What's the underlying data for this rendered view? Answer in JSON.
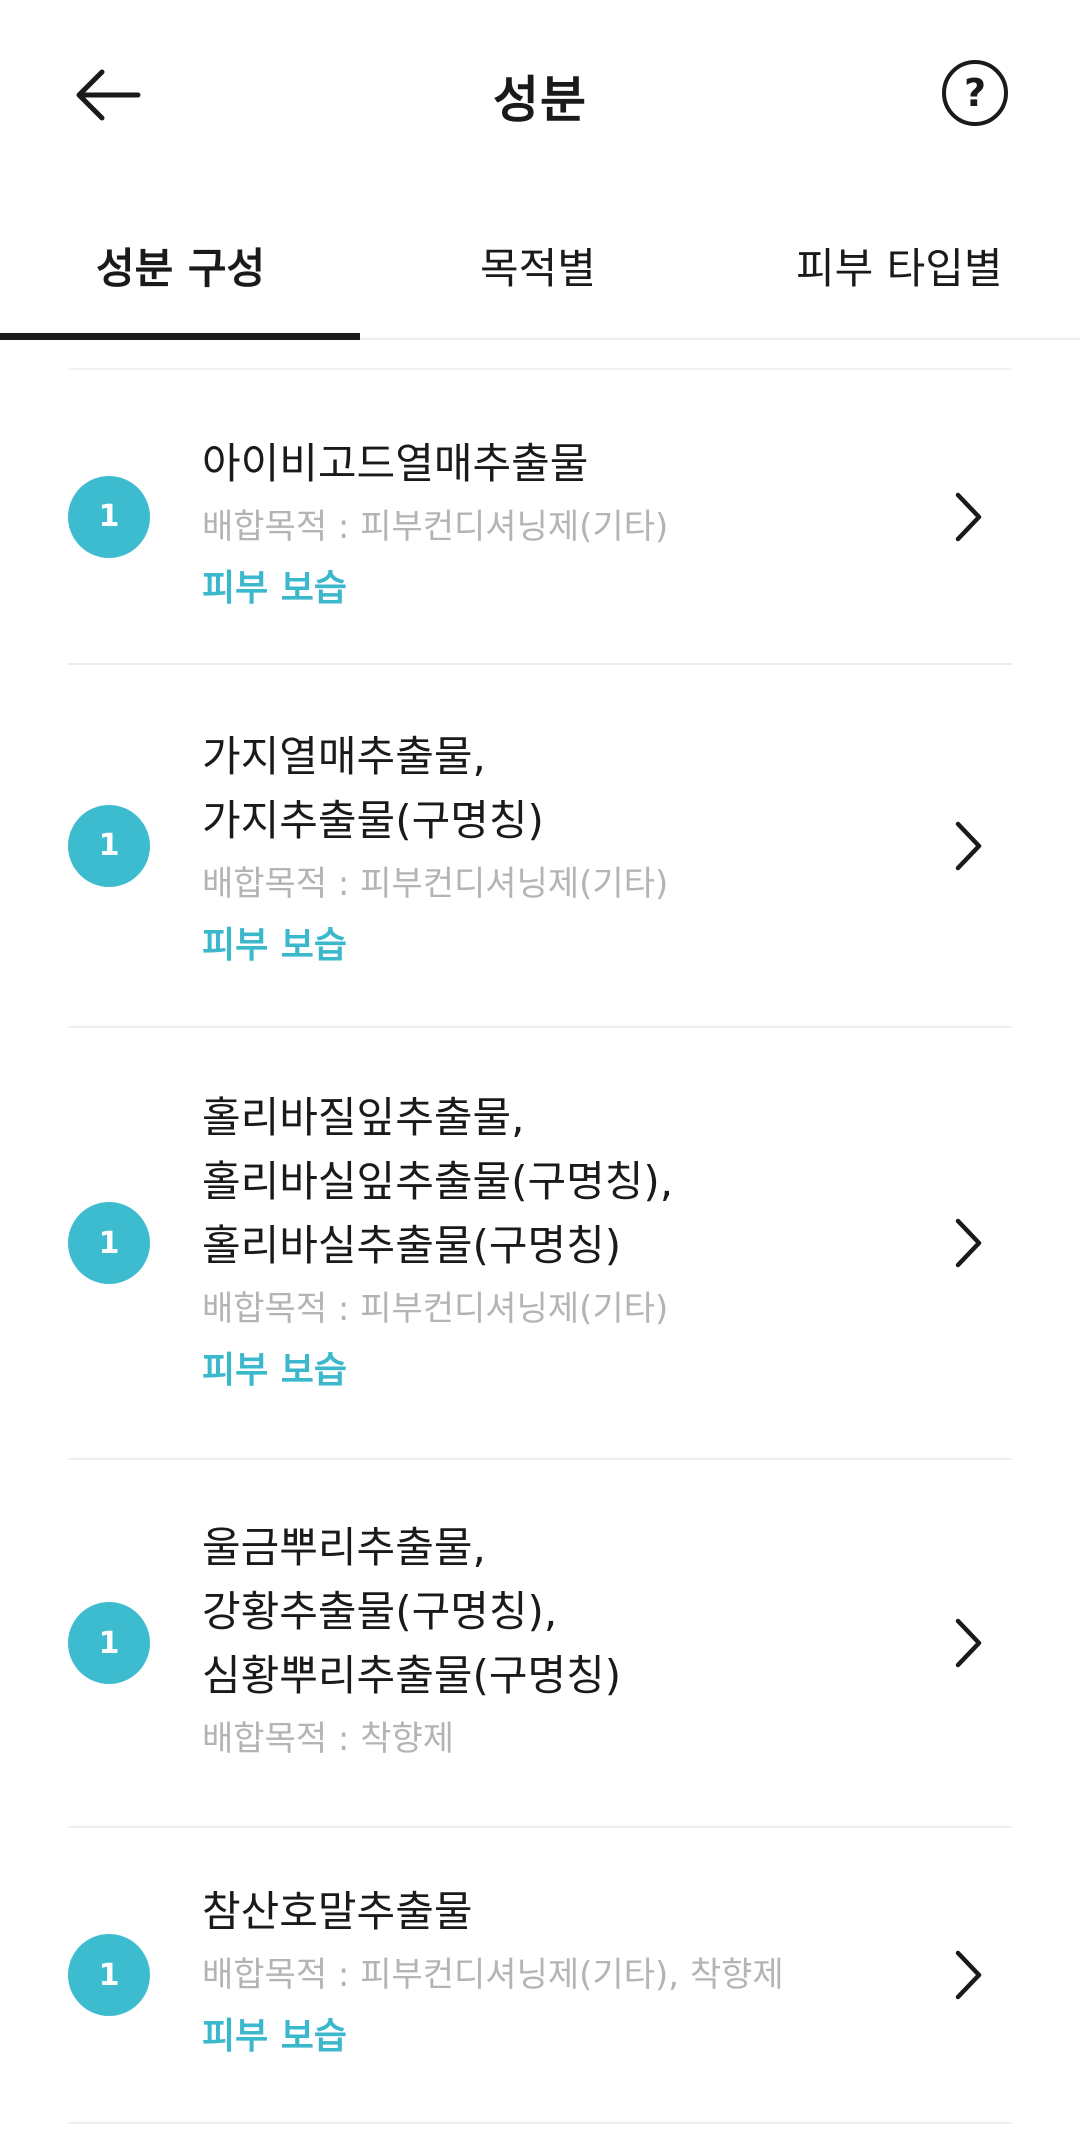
{
  "header": {
    "title": "성분",
    "help_label": "?"
  },
  "tabs": [
    {
      "label": "성분 구성",
      "active": true
    },
    {
      "label": "목적별",
      "active": false
    },
    {
      "label": "피부 타입별",
      "active": false
    }
  ],
  "colors": {
    "accent": "#3dbcd0",
    "effect_text": "#3bb8cc",
    "muted_text": "#b4b4b4"
  },
  "items": [
    {
      "badge": "1",
      "name_lines": [
        "아이비고드열매추출물"
      ],
      "purpose": "배합목적 : 피부컨디셔닝제(기타)",
      "effect": "피부 보습"
    },
    {
      "badge": "1",
      "name_lines": [
        "가지열매추출물,",
        "가지추출물(구명칭)"
      ],
      "purpose": "배합목적 : 피부컨디셔닝제(기타)",
      "effect": "피부 보습"
    },
    {
      "badge": "1",
      "name_lines": [
        "홀리바질잎추출물,",
        "홀리바실잎추출물(구명칭),",
        "홀리바실추출물(구명칭)"
      ],
      "purpose": "배합목적 : 피부컨디셔닝제(기타)",
      "effect": "피부 보습"
    },
    {
      "badge": "1",
      "name_lines": [
        "울금뿌리추출물,",
        "강황추출물(구명칭),",
        "심황뿌리추출물(구명칭)"
      ],
      "purpose": "배합목적 : 착향제",
      "effect": ""
    },
    {
      "badge": "1",
      "name_lines": [
        "참산호말추출물"
      ],
      "purpose": "배합목적 : 피부컨디셔닝제(기타), 착향제",
      "effect": "피부 보습"
    }
  ]
}
